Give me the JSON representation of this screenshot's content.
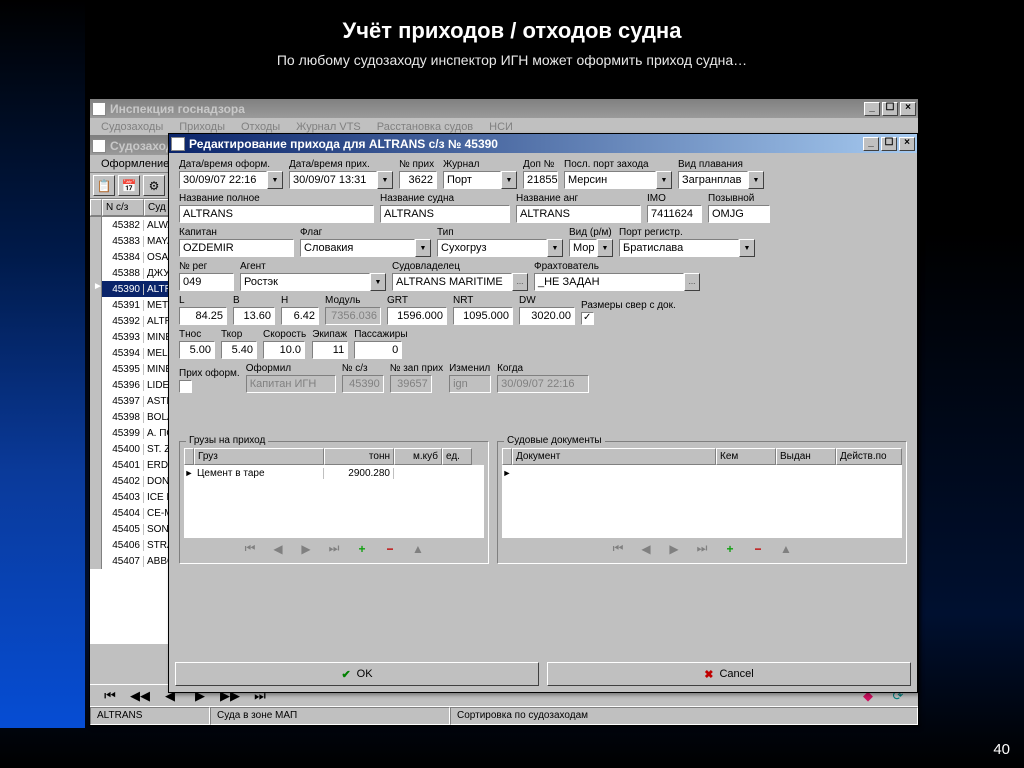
{
  "slide": {
    "title": "Учёт приходов / отходов судна",
    "subtitle": "По любому судозаходу инспектор ИГН может оформить приход судна…",
    "page": "40"
  },
  "mainWindow": {
    "title": "Инспекция госнадзора",
    "menu": [
      "Судозаходы",
      "Приходы",
      "Отходы",
      "Журнал VTS",
      "Расстановка судов",
      "НСИ"
    ]
  },
  "childWindow": {
    "title": "Судозаходы",
    "menu": [
      "Оформление",
      "Суд"
    ]
  },
  "grid": {
    "col_id": "N с/з",
    "col_name": "Суд",
    "rows": [
      {
        "id": "45382",
        "name": "ALWADI"
      },
      {
        "id": "45383",
        "name": "MAYA LAND"
      },
      {
        "id": "45384",
        "name": "OSAMA"
      },
      {
        "id": "45388",
        "name": "ДЖУЛЬЕТТА"
      },
      {
        "id": "45390",
        "name": "ALTRANS",
        "sel": true
      },
      {
        "id": "45391",
        "name": "METIN AKAR"
      },
      {
        "id": "45392",
        "name": "ALTRANY"
      },
      {
        "id": "45393",
        "name": "MINERVA NIK"
      },
      {
        "id": "45394",
        "name": "MELISSA K"
      },
      {
        "id": "45395",
        "name": "MINERVA EM"
      },
      {
        "id": "45396",
        "name": "LIDER SAFAK"
      },
      {
        "id": "45397",
        "name": "ASTRA."
      },
      {
        "id": "45398",
        "name": "BOLAMAN"
      },
      {
        "id": "45399",
        "name": "А. ПОКРЫШК"
      },
      {
        "id": "45400",
        "name": "ST. ZOYA"
      },
      {
        "id": "45401",
        "name": "ERDOGAN SE"
      },
      {
        "id": "45402",
        "name": "DONAT"
      },
      {
        "id": "45403",
        "name": "ICE BELL"
      },
      {
        "id": "45404",
        "name": "CE-MERAPI"
      },
      {
        "id": "45405",
        "name": "SONG SHI HA"
      },
      {
        "id": "45406",
        "name": "STRANGE AT"
      },
      {
        "id": "45407",
        "name": "ABBOUD G"
      }
    ]
  },
  "dialog": {
    "title": "Редактирование прихода для ALTRANS с/з № 45390",
    "labels": {
      "dt_reg": "Дата/время оформ.",
      "dt_arr": "Дата/время прих.",
      "n_arr": "№ прих",
      "journal": "Журнал",
      "add_no": "Доп №",
      "last_port": "Посл. порт захода",
      "sail_type": "Вид плавания",
      "name_full": "Название полное",
      "name_ship": "Название судна",
      "name_en": "Название анг",
      "imo": "IMO",
      "callsign": "Позывной",
      "captain": "Капитан",
      "flag": "Флаг",
      "type": "Тип",
      "kind": "Вид (р/м)",
      "port_reg": "Порт регистр.",
      "reg_no": "№ рег",
      "agent": "Агент",
      "owner": "Судовладелец",
      "charterer": "Фрахтователь",
      "L": "L",
      "B": "B",
      "H": "H",
      "module": "Модуль",
      "grt": "GRT",
      "nrt": "NRT",
      "dw": "DW",
      "oversize": "Размеры свер с док.",
      "tnos": "Тнос",
      "tkor": "Ткор",
      "speed": "Скорость",
      "crew": "Экипаж",
      "pax": "Пассажиры",
      "arr_done": "Прих оформ.",
      "who": "Оформил",
      "n_sz": "№  с/з",
      "n_rec": "№ зап прих",
      "changed": "Изменил",
      "when": "Когда"
    },
    "values": {
      "dt_reg": "30/09/07 22:16",
      "dt_arr": "30/09/07 13:31",
      "n_arr": "3622",
      "journal": "Порт",
      "add_no": "21855",
      "last_port": "Мерсин",
      "sail_type": "Загранплав",
      "name_full": "ALTRANS",
      "name_ship": "ALTRANS",
      "name_en": "ALTRANS",
      "imo": "7411624",
      "callsign": "OMJG",
      "captain": "OZDEMIR",
      "flag": "Словакия",
      "type": "Сухогруз",
      "kind": "Мор",
      "port_reg": "Братислава",
      "reg_no": "049",
      "agent": "Ростэк",
      "owner": "ALTRANS MARITIME",
      "charterer": "_НЕ ЗАДАН",
      "L": "84.25",
      "B": "13.60",
      "H": "6.42",
      "module": "7356.036",
      "grt": "1596.000",
      "nrt": "1095.000",
      "dw": "3020.00",
      "tnos": "5.00",
      "tkor": "5.40",
      "speed": "10.0",
      "crew": "11",
      "pax": "0",
      "who": "Капитан ИГН",
      "n_sz": "45390",
      "n_rec": "39657",
      "changed": "ign",
      "when": "30/09/07 22:16"
    },
    "cargo": {
      "title": "Грузы на приход",
      "cols": {
        "name": "Груз",
        "tons": "тонн",
        "m3": "м.куб",
        "unit": "ед."
      },
      "rows": [
        {
          "name": "Цемент в таре",
          "tons": "2900.280",
          "m3": "",
          "unit": ""
        }
      ]
    },
    "docs": {
      "title": "Судовые документы",
      "cols": {
        "doc": "Документ",
        "by": "Кем",
        "issued": "Выдан",
        "valid": "Действ.по"
      }
    },
    "buttons": {
      "ok": "OK",
      "cancel": "Cancel"
    }
  },
  "status": {
    "s1": "ALTRANS",
    "s2": "Суда в зоне МАП",
    "s3": "Сортировка по судозаходам"
  }
}
